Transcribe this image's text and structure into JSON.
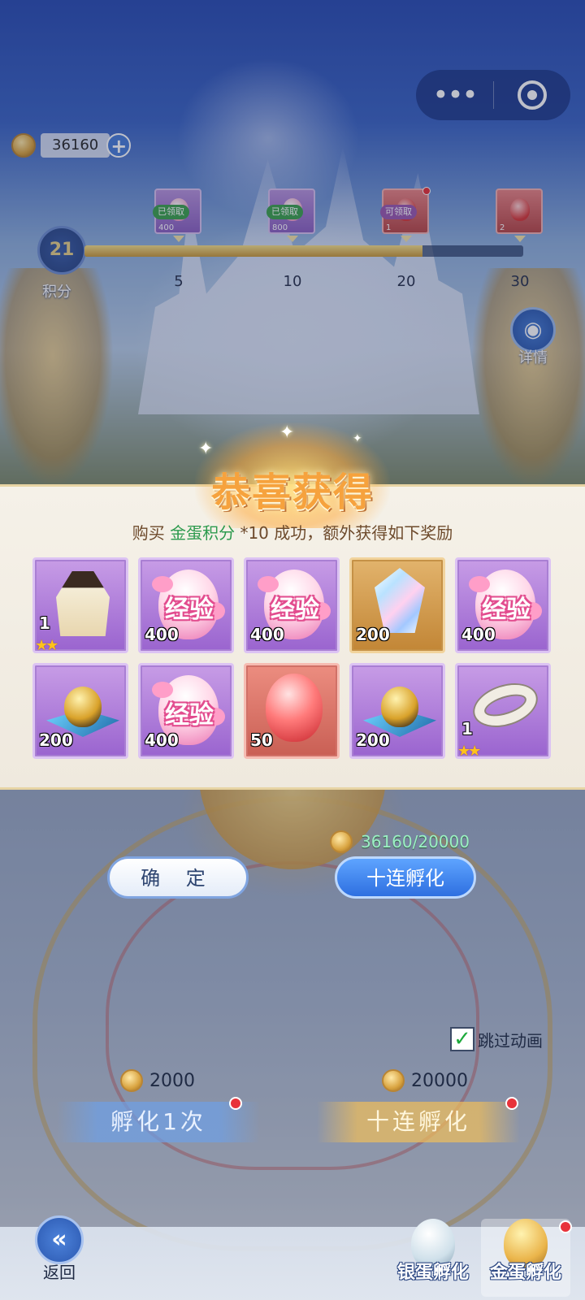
{
  "capsule": {
    "more_icon": "more-dots-icon",
    "target_icon": "target-icon",
    "more_glyph": "•••"
  },
  "currency": {
    "icon": "gold-egg-coin-icon",
    "amount": "36160",
    "plus": "+"
  },
  "progress": {
    "score": "21",
    "score_label": "积分",
    "fill_fraction": 0.77,
    "milestones": [
      {
        "num": "5",
        "tag": "已领取",
        "qty": "400"
      },
      {
        "num": "10",
        "tag": "已领取",
        "qty": "800"
      },
      {
        "num": "20",
        "tag": "可领取",
        "qty": "1"
      },
      {
        "num": "30",
        "tag": "",
        "qty": "2"
      }
    ]
  },
  "detail": {
    "icon": "book-icon",
    "label": "详情",
    "glyph": "◉"
  },
  "dialog": {
    "title": "恭喜获得",
    "sub_prefix": "购买 ",
    "sub_highlight": "金蛋积分",
    "sub_suffix": " *10 成功，额外获得如下奖励",
    "exp_text": "经验",
    "items": [
      {
        "name": "cape",
        "qty": "1",
        "stars": "★★"
      },
      {
        "name": "exp-egg",
        "qty": "400"
      },
      {
        "name": "exp-egg",
        "qty": "400"
      },
      {
        "name": "crystal",
        "qty": "200"
      },
      {
        "name": "exp-egg",
        "qty": "400"
      },
      {
        "name": "gold-egg",
        "qty": "200"
      },
      {
        "name": "exp-egg",
        "qty": "400"
      },
      {
        "name": "red-egg",
        "qty": "50"
      },
      {
        "name": "gold-egg",
        "qty": "200"
      },
      {
        "name": "ring",
        "qty": "1",
        "stars": "★★"
      }
    ]
  },
  "actions": {
    "confirm": "确 定",
    "ten_hatch": "十连孵化",
    "cost_line": "36160/20000"
  },
  "hatch": {
    "skip_label": "跳过动画",
    "skip_check": "✓",
    "one_cost": "2000",
    "ten_cost": "20000",
    "one_label": "孵化1次",
    "ten_label": "十连孵化"
  },
  "bottom": {
    "back_label": "返回",
    "back_glyph": "«",
    "silver_tab": "银蛋孵化",
    "gold_tab": "金蛋孵化"
  },
  "colors": {
    "accent_blue": "#2e6fe0",
    "title_orange": "#f6a23d",
    "highlight_green": "#2c9a4d",
    "purple_cell": "#9a64cf"
  }
}
